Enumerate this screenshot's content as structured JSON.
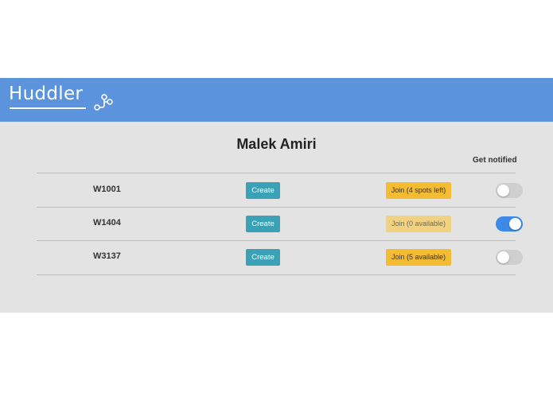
{
  "app": {
    "name": "Huddler",
    "header_color": "#5b93dc",
    "logo_icon": "branch-nodes-icon"
  },
  "user": {
    "name": "Malek Amiri"
  },
  "columns": {
    "notify_label": "Get notified"
  },
  "rooms": [
    {
      "code": "W1001",
      "create_label": "Create",
      "join_label": "Join (4 spots left)",
      "join_enabled": true,
      "notify": false
    },
    {
      "code": "W1404",
      "create_label": "Create",
      "join_label": "Join (0 available)",
      "join_enabled": false,
      "notify": true
    },
    {
      "code": "W3137",
      "create_label": "Create",
      "join_label": "Join (5 available)",
      "join_enabled": true,
      "notify": false
    }
  ],
  "colors": {
    "create_button": "#3aa1b6",
    "join_button": "#f3bc32",
    "join_button_disabled": "#f0d280",
    "toggle_on": "#3c89e8",
    "toggle_off": "#cfcfcf"
  }
}
